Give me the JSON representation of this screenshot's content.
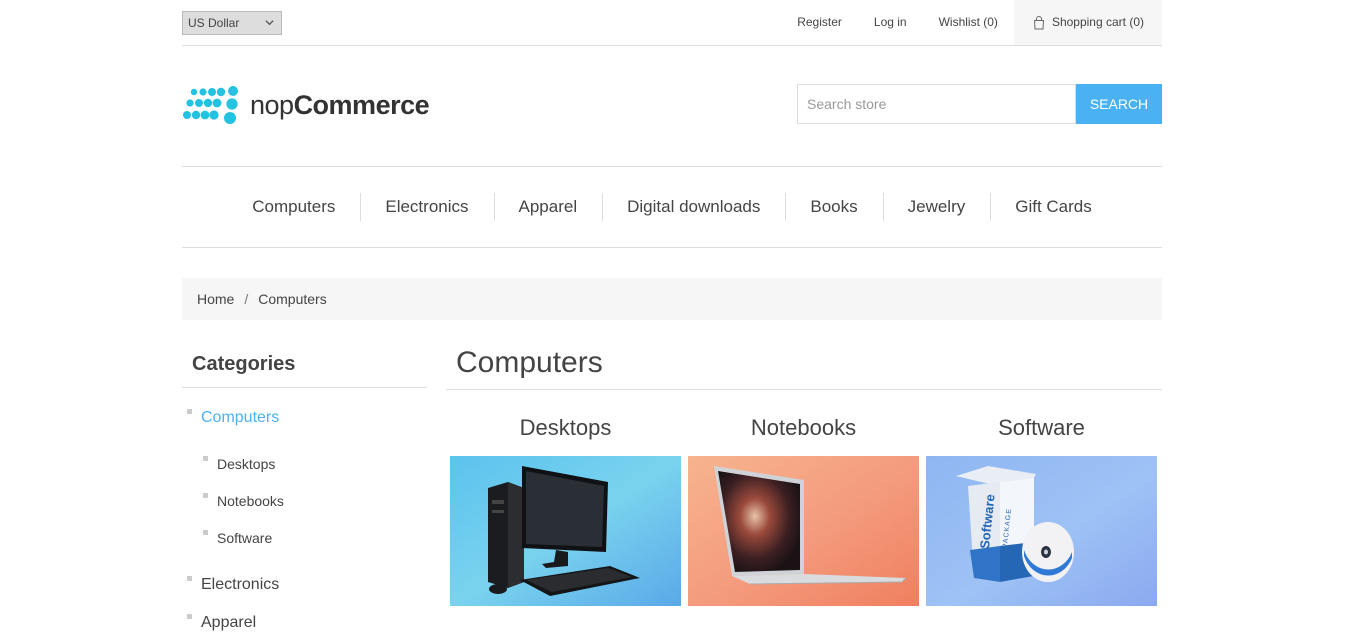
{
  "header": {
    "currency": "US Dollar",
    "links": {
      "register": "Register",
      "login": "Log in",
      "wishlist": "Wishlist (0)",
      "cart": "Shopping cart (0)"
    }
  },
  "logo": {
    "text_light": "nop",
    "text_bold": "Commerce",
    "dot_color": "#23c2e0"
  },
  "search": {
    "placeholder": "Search store",
    "button": "Search",
    "accent": "#4ab2f1"
  },
  "menu": [
    "Computers",
    "Electronics",
    "Apparel",
    "Digital downloads",
    "Books",
    "Jewelry",
    "Gift Cards"
  ],
  "breadcrumb": {
    "home": "Home",
    "separator": "/",
    "current": "Computers"
  },
  "sidebar": {
    "title": "Categories",
    "active": "Computers",
    "subitems": [
      "Desktops",
      "Notebooks",
      "Software"
    ],
    "others": [
      "Electronics",
      "Apparel"
    ]
  },
  "page": {
    "title": "Computers",
    "subcategories": [
      {
        "name": "Desktops",
        "icon": "desktop-computer-image"
      },
      {
        "name": "Notebooks",
        "icon": "laptop-image"
      },
      {
        "name": "Software",
        "icon": "software-box-image"
      }
    ],
    "software_box": {
      "title": "Software",
      "subtitle": "PACKAGE"
    }
  }
}
